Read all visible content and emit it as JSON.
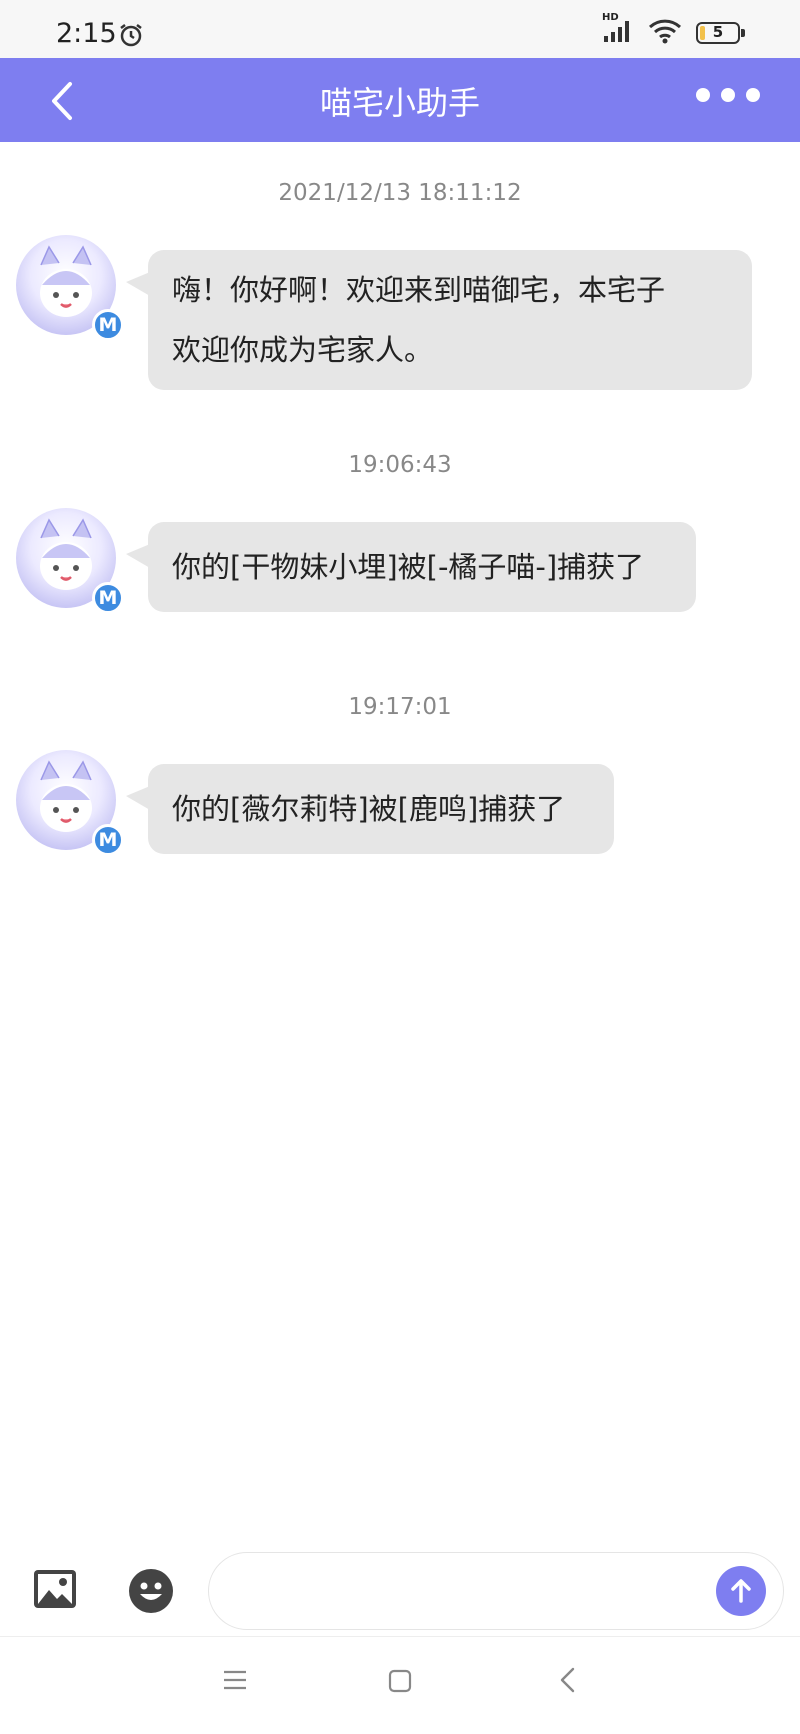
{
  "status_bar": {
    "time": "2:15",
    "network": "HD",
    "battery_level": "5",
    "icons": [
      "alarm-icon",
      "signal-icon",
      "wifi-icon",
      "battery-icon"
    ]
  },
  "header": {
    "title": "喵宅小助手",
    "back_icon": "chevron-left-icon",
    "more_icon": "more-dots-icon",
    "background_color": "#7e7ef0"
  },
  "messages": [
    {
      "timestamp": "2021/12/13 18:11:12",
      "sender": "喵宅小助手",
      "avatar_badge": "M",
      "lines": [
        "嗨！你好啊！欢迎来到喵御宅，本宅子",
        "欢迎你成为宅家人。"
      ]
    },
    {
      "timestamp": "19:06:43",
      "sender": "喵宅小助手",
      "avatar_badge": "M",
      "lines": [
        "你的[干物妹小埋]被[-橘子喵-]捕获了"
      ]
    },
    {
      "timestamp": "19:17:01",
      "sender": "喵宅小助手",
      "avatar_badge": "M",
      "lines": [
        "你的[薇尔莉特]被[鹿鸣]捕获了"
      ]
    }
  ],
  "input_bar": {
    "image_icon": "image-icon",
    "emoji_icon": "emoji-icon",
    "message_value": "",
    "send_icon": "arrow-up-icon",
    "accent_color": "#7e7ef0"
  },
  "nav_bar": {
    "icons": [
      "menu-icon",
      "home-square-icon",
      "back-triangle-icon"
    ]
  }
}
